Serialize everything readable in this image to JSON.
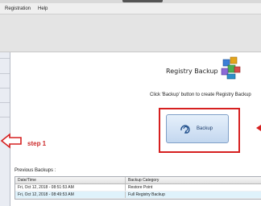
{
  "menu": {
    "items": [
      "Registration",
      "Help"
    ]
  },
  "registry_backup": {
    "title": "Registry Backup",
    "instruction": "Click 'Backup' button to create Registry Backup",
    "backup_button_label": "Backup",
    "icon": "registry-cubes-icon"
  },
  "annotation": {
    "step_label": "step 1"
  },
  "previous_backups": {
    "label": "Previous Backups :",
    "columns": [
      "Date/Time",
      "Backup Category"
    ],
    "rows": [
      [
        "Fri, Oct 12, 2018 - 08:51:53 AM",
        "Restore Point"
      ],
      [
        "Fri, Oct 12, 2018 - 08:49:53 AM",
        "Full Registry Backup"
      ]
    ]
  },
  "colors": {
    "annotation_red": "#d62020",
    "selected_row": "#dff2fb",
    "button_blue": "#c3d7ef"
  }
}
